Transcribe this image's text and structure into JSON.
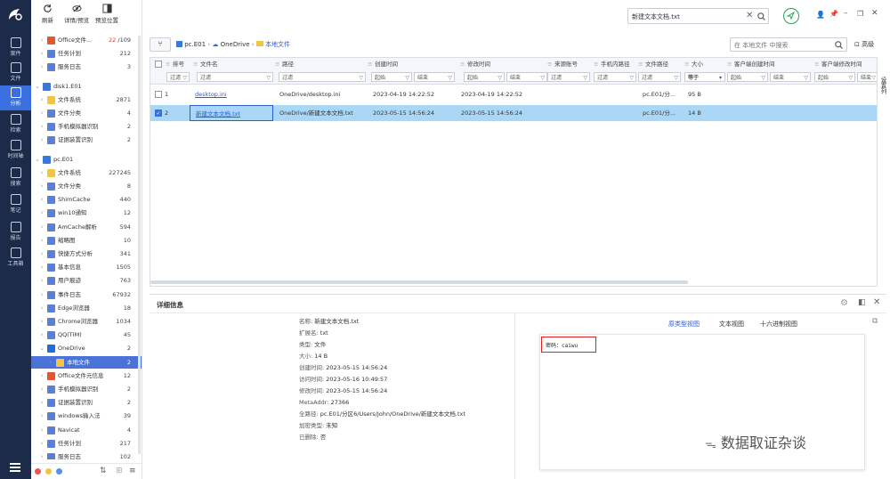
{
  "toolbar": {
    "refresh": "刷新",
    "detail_preview": "详情/预览",
    "preview_position": "预览位置"
  },
  "nav": [
    {
      "label": "案件",
      "icon": "case-icon"
    },
    {
      "label": "文件",
      "icon": "file-icon"
    },
    {
      "label": "分析",
      "icon": "analysis-icon"
    },
    {
      "label": "检索",
      "icon": "search-icon"
    },
    {
      "label": "时间轴",
      "icon": "timeline-icon"
    },
    {
      "label": "搜索",
      "icon": "search-icon"
    },
    {
      "label": "笔记",
      "icon": "note-icon"
    },
    {
      "label": "报告",
      "icon": "report-icon"
    },
    {
      "label": "工具箱",
      "icon": "toolbox-icon"
    }
  ],
  "tree": [
    {
      "label": "Office文件...",
      "count": "/109",
      "count_red": "22",
      "indent": 1,
      "icon": "office"
    },
    {
      "label": "任务计划",
      "count": "212",
      "indent": 1,
      "icon": "doc"
    },
    {
      "label": "服务日志",
      "count": "3",
      "indent": 1,
      "icon": "doc"
    },
    {
      "label": "disk1.E01",
      "count": "",
      "indent": 0,
      "icon": "win"
    },
    {
      "label": "文件系统",
      "count": "2871",
      "indent": 1,
      "icon": "folder"
    },
    {
      "label": "文件分类",
      "count": "4",
      "indent": 1,
      "icon": "doc"
    },
    {
      "label": "手机模拟器识别",
      "count": "2",
      "indent": 1,
      "icon": "doc"
    },
    {
      "label": "证据装置识别",
      "count": "2",
      "indent": 1,
      "icon": "doc"
    },
    {
      "label": "pc.E01",
      "count": "",
      "indent": 0,
      "icon": "win"
    },
    {
      "label": "文件系统",
      "count": "227245",
      "indent": 1,
      "icon": "folder"
    },
    {
      "label": "文件分类",
      "count": "8",
      "indent": 1,
      "icon": "doc"
    },
    {
      "label": "ShimCache",
      "count": "440",
      "indent": 1,
      "icon": "doc"
    },
    {
      "label": "win10通知",
      "count": "12",
      "indent": 1,
      "icon": "doc"
    },
    {
      "label": "AmCache解析",
      "count": "594",
      "indent": 1,
      "icon": "doc"
    },
    {
      "label": "缩略图",
      "count": "10",
      "indent": 1,
      "icon": "doc"
    },
    {
      "label": "快捷方式分析",
      "count": "341",
      "indent": 1,
      "icon": "doc"
    },
    {
      "label": "基本信息",
      "count": "1505",
      "indent": 1,
      "icon": "doc"
    },
    {
      "label": "用户痕迹",
      "count": "763",
      "indent": 1,
      "icon": "doc"
    },
    {
      "label": "事件日志",
      "count": "67932",
      "indent": 1,
      "icon": "doc"
    },
    {
      "label": "Edge浏览器",
      "count": "18",
      "indent": 1,
      "icon": "doc"
    },
    {
      "label": "Chrome浏览器",
      "count": "1034",
      "indent": 1,
      "icon": "doc"
    },
    {
      "label": "QQ(TIM)",
      "count": "45",
      "indent": 1,
      "icon": "doc"
    },
    {
      "label": "OneDrive",
      "count": "2",
      "indent": 1,
      "icon": "cloud"
    },
    {
      "label": "本地文件",
      "count": "2",
      "indent": 2,
      "icon": "folder",
      "selected": true
    },
    {
      "label": "Office文件元信息",
      "count": "12",
      "indent": 1,
      "icon": "office"
    },
    {
      "label": "手机模拟器识别",
      "count": "2",
      "indent": 1,
      "icon": "doc"
    },
    {
      "label": "证据装置识别",
      "count": "2",
      "indent": 1,
      "icon": "doc"
    },
    {
      "label": "windows输入法",
      "count": "39",
      "indent": 1,
      "icon": "doc"
    },
    {
      "label": "Navicat",
      "count": "4",
      "indent": 1,
      "icon": "doc"
    },
    {
      "label": "任务计划",
      "count": "217",
      "indent": 1,
      "icon": "doc"
    },
    {
      "label": "服务日志",
      "count": "102",
      "indent": 1,
      "icon": "doc"
    }
  ],
  "search": {
    "value": "新建文本文档.txt"
  },
  "breadcrumb": {
    "root": "pc.E01",
    "mid": "OneDrive",
    "leaf": "本地文件"
  },
  "local_search": {
    "placeholder": "在 本地文件 中搜索",
    "advanced": "高级"
  },
  "table": {
    "headers": [
      "排号",
      "文件名",
      "路径",
      "创建时间",
      "修改时间",
      "来源账号",
      "手机内路径",
      "文件路径",
      "大小",
      "客户端创建时间",
      "客户端修改时间"
    ],
    "filter": "过滤",
    "start": "起始",
    "end": "结束",
    "equals": "等于",
    "rows": [
      {
        "no": "1",
        "name": "desktop.ini",
        "path": "OneDrive/desktop.ini",
        "ctime": "2023-04-19 14:22:52",
        "mtime": "2023-04-19 14:22:52",
        "fpath": "pc.E01/分...",
        "size": "95 B",
        "checked": false
      },
      {
        "no": "2",
        "name": "新建文本文档.txt",
        "path": "OneDrive/新建文本文档.txt",
        "ctime": "2023-05-15 14:56:24",
        "mtime": "2023-05-15 14:56:24",
        "fpath": "pc.E01/分...",
        "size": "14 B",
        "checked": true
      }
    ]
  },
  "side_tab": "设置列",
  "detail": {
    "title": "详细信息",
    "fields": [
      {
        "k": "名称:",
        "v": "新建文本文档.txt"
      },
      {
        "k": "扩展名:",
        "v": "txt"
      },
      {
        "k": "类型:",
        "v": "文件"
      },
      {
        "k": "大小:",
        "v": "14 B"
      },
      {
        "k": "创建时间:",
        "v": "2023-05-15 14:56:24"
      },
      {
        "k": "访问时间:",
        "v": "2023-05-16 10:49:57"
      },
      {
        "k": "修改时间:",
        "v": "2023-05-15 14:56:24"
      },
      {
        "k": "MetaAddr:",
        "v": "27366"
      },
      {
        "k": "全路径:",
        "v": "pc.E01/分区6/Users/John/OneDrive/新建文本文档.txt"
      },
      {
        "k": "加密类型:",
        "v": "未知"
      },
      {
        "k": "已删除:",
        "v": "否"
      }
    ],
    "tabs": [
      "原类型视图",
      "文本视图",
      "十六进制视图"
    ],
    "content": "密码：caiwu"
  },
  "watermark": "数据取证杂谈",
  "colors": {
    "nav_bg": "#1c2b4a",
    "accent": "#3b6fe0",
    "selected_row": "#a9d7f5",
    "highlight_box": "#e02020"
  }
}
